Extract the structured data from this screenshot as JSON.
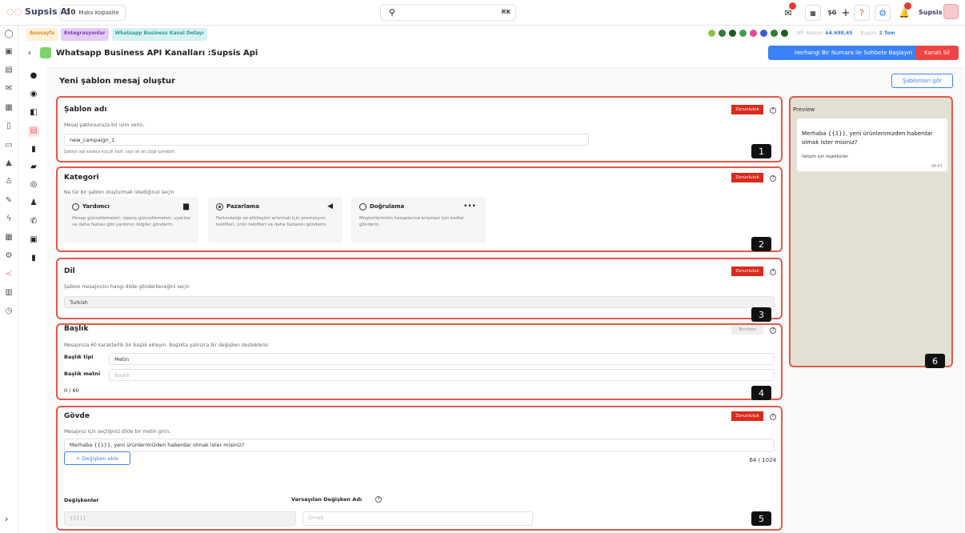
{
  "topbar": {
    "logo": "Supsis AI",
    "workspace_num": "10",
    "workspace_label": "Maks Kopasite",
    "search_kbd": "⌘K",
    "user": "Supsis"
  },
  "breadcrumbs": [
    "Anasayfa",
    "Entegrasyonlar",
    "Whatsapp Business Kanal Detayı"
  ],
  "status": {
    "balance_label": "WP. Bakiye:",
    "balance_value": "₺4.698,45",
    "today_label": "Bugün:",
    "today_value": "2 Tem"
  },
  "title_bar": {
    "title": "Whatsapp Business API Kanalları :Supsis Api",
    "start_chat_button": "Herhangi Bir Numara ile Sohbete Başlayın",
    "delete_button": "Kanalı Sil"
  },
  "page": {
    "heading": "Yeni şablon mesaj oluştur",
    "templates_button": "Şablonları gör"
  },
  "sections": {
    "required_label": "Zorunluluk",
    "optional_label": "Tercihen",
    "name": {
      "title": "Şablon adı",
      "desc": "Mesaj şablonunuza bir isim verin.",
      "value": "new_campaign_1",
      "hint": "Şablon adı sadece küçük harf, sayı ve alt çizgi içerebilir.",
      "number": "1"
    },
    "category": {
      "title": "Kategori",
      "desc": "Ne tür bir şablon oluşturmak istediğinizi seçin",
      "number": "2",
      "options": [
        {
          "name": "Yardımcı",
          "desc": "Hesap güncellemeleri, sipariş güncellemeleri, uyarılar ve daha fazlası gibi yardımcı bilgiler gönderin."
        },
        {
          "name": "Pazarlama",
          "desc": "Farkındalığı ve etkileşimi artırmak için promosyon teklifleri, ürün teklifleri ve daha fazlasını gönderin."
        },
        {
          "name": "Doğrulama",
          "desc": "Müşterilerinizin hesaplarına erişmesi için kodlar gönderin."
        }
      ]
    },
    "language": {
      "title": "Dil",
      "desc": "Şablon mesajınızın hangi dilde gönderileceğini seçin",
      "value": "Turkish",
      "number": "3"
    },
    "header": {
      "title": "Başlık",
      "desc": "Mesajınıza 60 karakterlik bir başlık ekleyin. Başlıkta yalnızca bir değişken desteklenir.",
      "type_label": "Başlık tipi",
      "type_value": "Metin",
      "text_label": "Başlık metni",
      "text_placeholder": "Başlık",
      "counter": "0 / 60",
      "number": "4"
    },
    "body": {
      "title": "Gövde",
      "desc": "Mesajınız için seçtiğiniz dilde bir metin girin.",
      "value": "Merhaba {{1}}, yeni ürünlerimizden haberdar olmak ister misiniz?",
      "add_variable": "+ Değişken ekle",
      "counter": "64 / 1024",
      "variables_label": "Değişkenler",
      "default_var_label": "Varsayılan Değişken Adı",
      "variable_value": "{{1}}",
      "example_placeholder": "Örnek",
      "number": "5"
    }
  },
  "preview": {
    "label": "Preview",
    "message": "Merhaba {{1}}, yeni ürünlerimizden haberdar olmak ister misiniz?",
    "footer": "İletişim için teşekkürler",
    "time": "08:43",
    "number": "6"
  }
}
